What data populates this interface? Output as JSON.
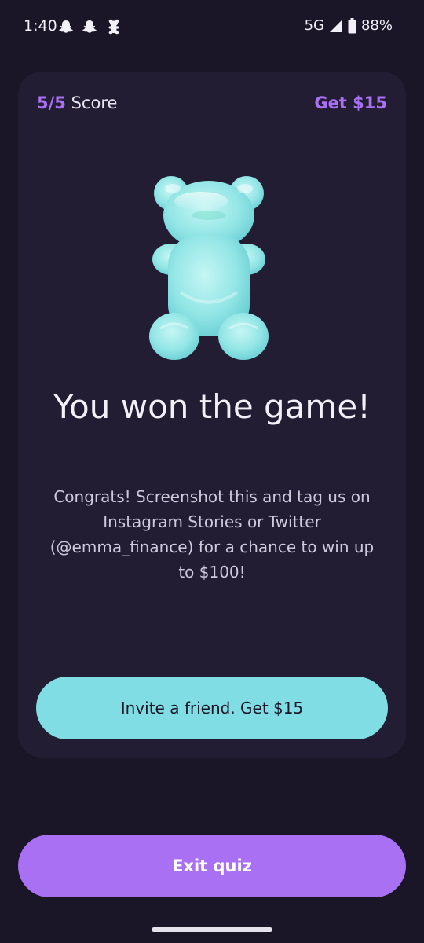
{
  "status_bar": {
    "time": "1:40",
    "network": "5G",
    "battery": "88%",
    "notification_icons": [
      "snapchat-icon",
      "snapchat-icon",
      "gummy-bear-icon"
    ]
  },
  "card": {
    "score_value": "5/5",
    "score_label": "Score",
    "get_link": "Get $15",
    "illustration": "gummy-bear-icon",
    "headline": "You won the game!",
    "body": "Congrats! Screenshot this and tag us on Instagram Stories or Twitter (@emma_finance) for a chance to win up to $100!",
    "invite_button": "Invite a friend. Get $15"
  },
  "exit_button": "Exit quiz",
  "colors": {
    "background": "#1a1527",
    "card": "#231d34",
    "accent_purple": "#a970f3",
    "accent_teal": "#7fdde3"
  }
}
